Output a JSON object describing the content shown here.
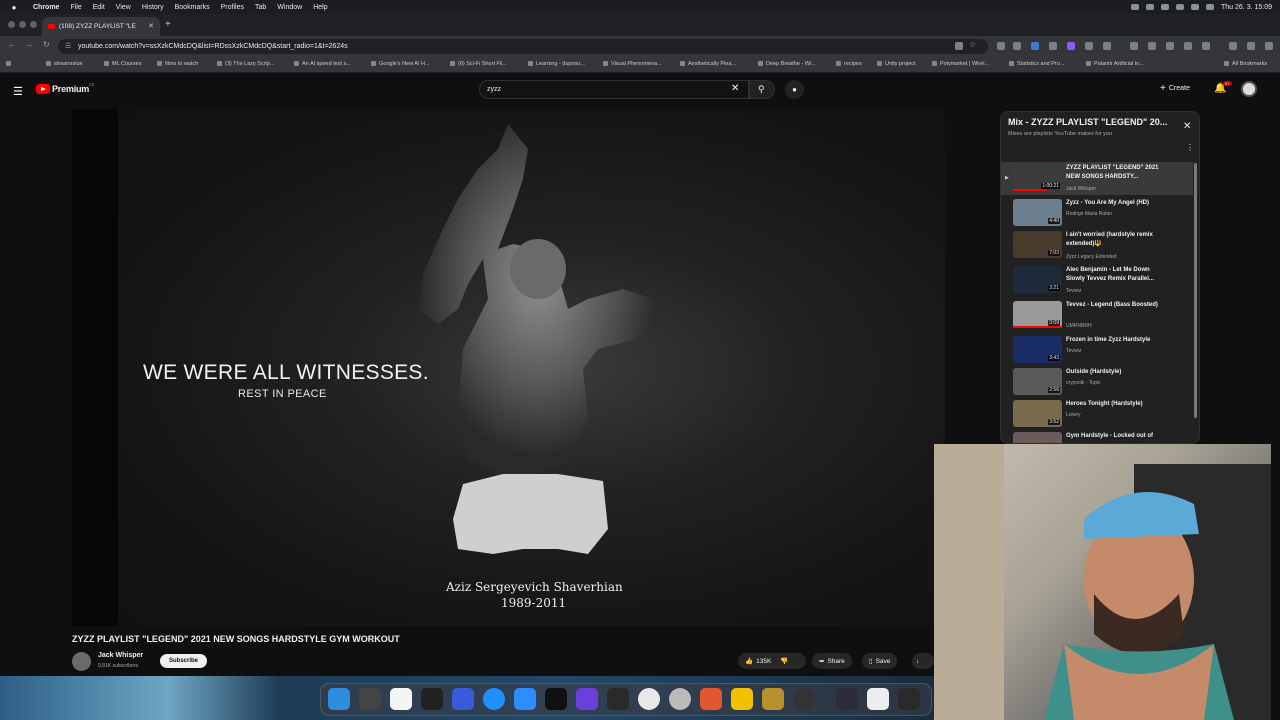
{
  "menubar": {
    "app": "Chrome",
    "items": [
      "File",
      "Edit",
      "View",
      "History",
      "Bookmarks",
      "Profiles",
      "Tab",
      "Window",
      "Help"
    ],
    "clock": "Thu 26. 3.  15:09"
  },
  "browser": {
    "tab_title": "(108) ZYZZ PLAYLIST \"LE",
    "url": "youtube.com/watch?v=ssXzkCMdcDQ&list=RDssXzkCMdcDQ&start_radio=1&t=2624s",
    "bookmarks": [
      "streamrslue",
      "ML Courses",
      "films to watch",
      "(3) The Lazy Scrip...",
      "An AI speed test s...",
      "Google's New AI H...",
      "(6) Sci-Fi Short Fil...",
      "Learning - duposu...",
      "Visual Phenomena...",
      "Aesthetically Plea...",
      "Deep Breathe - Wi...",
      "recipes",
      "Unity project",
      "Polymarket | Wirel...",
      "Statistics and Pro...",
      "Palantir Artificial In...",
      "All Bookmarks"
    ]
  },
  "youtube": {
    "brand": "Premium",
    "region": "CZ",
    "search_value": "zyzz",
    "create_label": "Create",
    "notifications": "9+"
  },
  "video": {
    "overlay_main": "WE WERE ALL WITNESSES.",
    "overlay_sub": "REST IN PEACE",
    "name_caption": "Aziz Sergeyevich Shaverhian",
    "years_caption": "1989-2011",
    "title": "ZYZZ PLAYLIST \"LEGEND\" 2021 NEW SONGS HARDSTYLE GYM WORKOUT",
    "channel": "Jack Whisper",
    "subscribers": "9.81K subscribers",
    "subscribe_label": "Subscribe",
    "likes": "135K",
    "share_label": "Share",
    "save_label": "Save"
  },
  "playlist": {
    "title": "Mix - ZYZZ PLAYLIST \"LEGEND\" 20...",
    "subtitle": "Mixes are playlists YouTube makes for you",
    "items": [
      {
        "title": "ZYZZ PLAYLIST \"LEGEND\" 2021 NEW SONGS HARDSTY...",
        "channel": "Jack Whisper",
        "duration": "1:00:21",
        "color": "#3c3c3c"
      },
      {
        "title": "Zyzz - You Are My Angel (HD)",
        "channel": "Rodrigo Maria Rubio",
        "duration": "4:40",
        "color": "#6c7f8e"
      },
      {
        "title": "I ain't worried (hardstyle remix extended)🔱",
        "channel": "Zyzz Legacy Extended",
        "duration": "7:03",
        "color": "#4a3c2c"
      },
      {
        "title": "Alec Benjamin - Let Me Down Slowly Tevvez Remix Parallel...",
        "channel": "Tevvez",
        "duration": "3:21",
        "color": "#1d2a3a"
      },
      {
        "title": "Tevvez - Legend (Bass Boosted)",
        "channel": "UMRNBRH",
        "duration": "3:09",
        "color": "#9a9a9a"
      },
      {
        "title": "Frozen in time Zyzz Hardstyle",
        "channel": "Tevvez",
        "duration": "3:43",
        "color": "#1a2c66"
      },
      {
        "title": "Outside (Hardstyle)",
        "channel": "crypvolk - Topic",
        "duration": "2:56",
        "color": "#5a5a5a"
      },
      {
        "title": "Heroes Tonight (Hardstyle)",
        "channel": "Loivey",
        "duration": "3:52",
        "color": "#7a6a4c"
      },
      {
        "title": "Gym Hardstyle - Locked out of",
        "channel": "",
        "duration": "",
        "color": "#6a5a5a"
      }
    ]
  }
}
